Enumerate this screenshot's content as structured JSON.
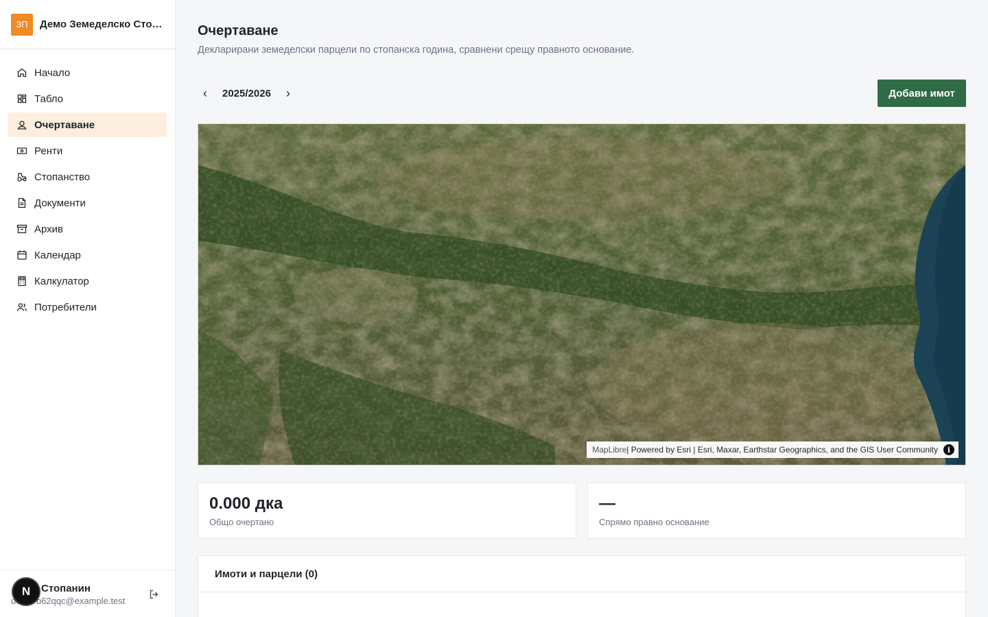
{
  "brand": {
    "logo_text": "ЗП",
    "name": "Демо Земеделско Стопанство",
    "color": "#f08a24"
  },
  "nav": {
    "active_color": "#fdeedd",
    "items": [
      {
        "label": "Начало",
        "icon": "home-icon"
      },
      {
        "label": "Табло",
        "icon": "dashboard-icon"
      },
      {
        "label": "Очертаване",
        "icon": "map-pin-icon",
        "active": true
      },
      {
        "label": "Ренти",
        "icon": "banknote-icon"
      },
      {
        "label": "Стопанство",
        "icon": "tractor-icon"
      },
      {
        "label": "Документи",
        "icon": "document-icon"
      },
      {
        "label": "Архив",
        "icon": "archive-icon"
      },
      {
        "label": "Календар",
        "icon": "calendar-icon"
      },
      {
        "label": "Калкулатор",
        "icon": "calculator-icon"
      },
      {
        "label": "Потребители",
        "icon": "users-icon"
      }
    ]
  },
  "user": {
    "name": "Стопанин",
    "email": "demo-b62qqc@example.test",
    "badge": "N"
  },
  "page": {
    "title": "Очертаване",
    "subtitle": "Декларирани земеделски парцели по стопанска година, сравнени срещу правното основание."
  },
  "season": {
    "label": "2025/2026",
    "prev": "‹",
    "next": "›"
  },
  "actions": {
    "add_label": "Добави имот",
    "primary_color": "#2f6b45"
  },
  "map": {
    "attribution_lib": "MapLibre",
    "attribution_text": " | Powered by Esri | Esri, Maxar, Earthstar Geographics, and the GIS User Community",
    "info_glyph": "i"
  },
  "stats": [
    {
      "value": "0.000 дка",
      "label": "Общо очертано"
    },
    {
      "value": "—",
      "label": "Спрямо правно основание"
    }
  ],
  "list": {
    "title": "Имоти и парцели (0)"
  }
}
